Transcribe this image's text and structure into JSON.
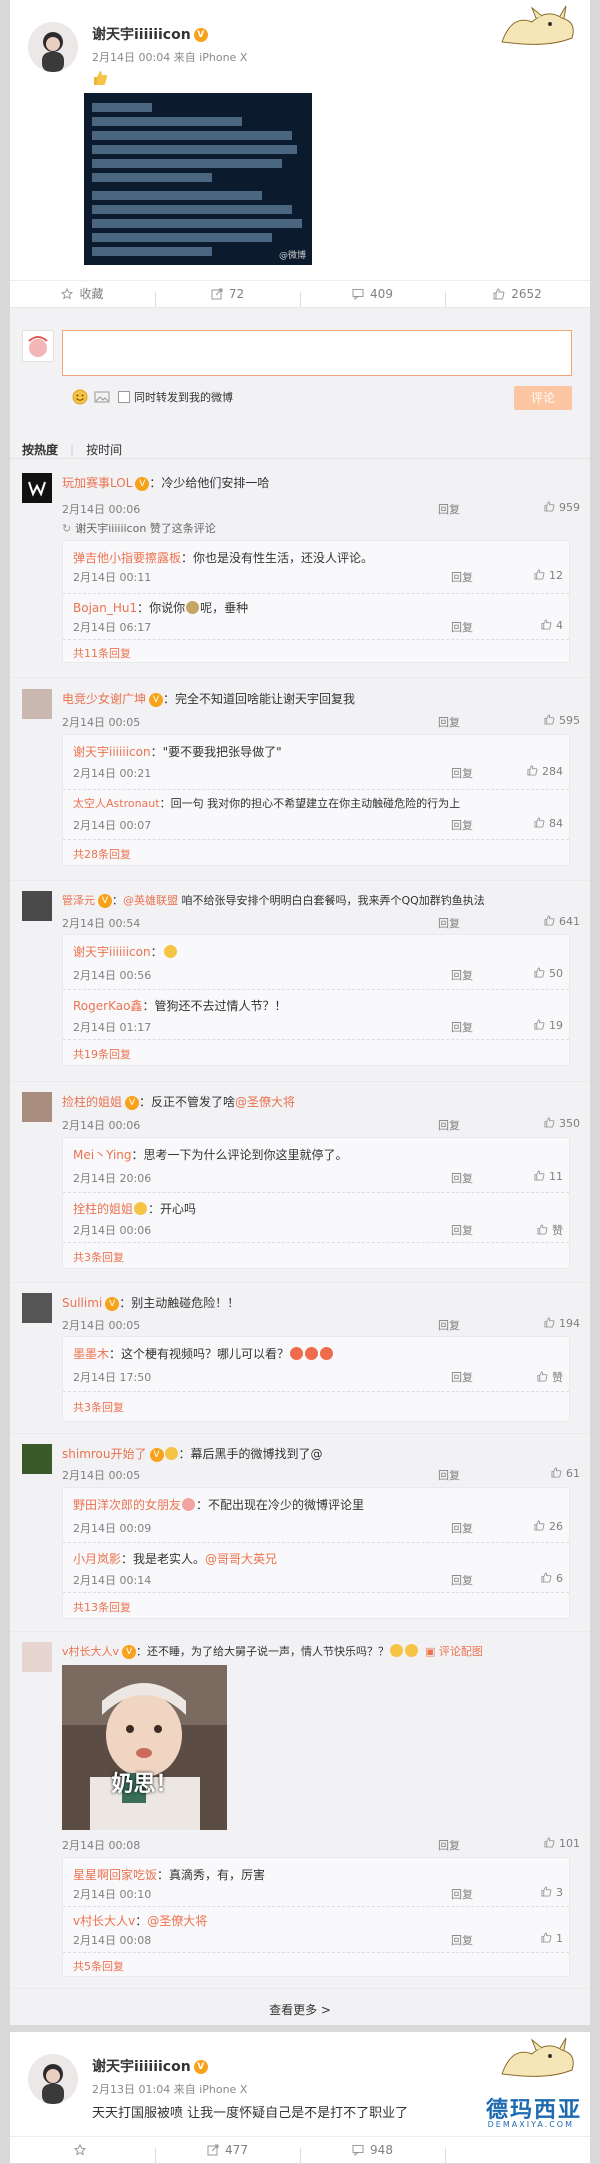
{
  "post1": {
    "author": "谢天宇iiiiiicon",
    "date": "2月14日 00:04",
    "source": "来自 iPhone X",
    "image_lines": [
      "小杯乐人：？？？",
      "杯乐人：D1最擅导张导替大家发上",
      "：我们粉租 有8000个号 4000台电脑 2000个手",
      "工✦伍 兄弟24小时为你服务！凡是加群633875387",
      "谢天宇张导请你别等你删号上✦看，安全，不对等",
      "天宇ICON：不和我们合作的",
      "D1最擅导张导替大家发上",
      "有8000个号 4000台电脑 2000个手",
      "兄弟24小时为你服务！凡是加群633875387",
      "张导请你别等你删号上✦看",
      "不对等回馈起"
    ],
    "image_watermark": "@微博",
    "actions": {
      "collect": "收藏",
      "forward": "72",
      "comment": "409",
      "like": "2652"
    }
  },
  "composer": {
    "sync_label": "同时转发到我的微博",
    "submit": "评论"
  },
  "sort": {
    "hot": "按热度",
    "time": "按时间"
  },
  "comments": [
    {
      "user": "玩加赛事LOL",
      "text": "：冷少给他们安排一哈",
      "time": "2月14日 00:06",
      "reply": "回复",
      "likes": "959",
      "liked_by": "谢天宇iiiiiicon 赞了这条评论",
      "subs": [
        {
          "user": "弹吉他小指要擦露板",
          "text": "：你也是没有性生活，还没人评论。",
          "time": "2月14日 00:11",
          "reply": "回复",
          "likes": "12"
        },
        {
          "user": "Bojan_Hu1",
          "text": "：你说你",
          "text2": "呢，垂种",
          "time": "2月14日 06:17",
          "reply": "回复",
          "likes": "4"
        }
      ],
      "more": "共11条回复"
    },
    {
      "user": "电竞少女谢广坤",
      "text": "：完全不知道回啥能让谢天宇回复我",
      "time": "2月14日 00:05",
      "reply": "回复",
      "likes": "595",
      "subs": [
        {
          "user": "谢天宇iiiiiicon",
          "text": "：\"要不要我把张导做了\"",
          "time": "2月14日 00:21",
          "reply": "回复",
          "likes": "284"
        },
        {
          "user": "太空人Astronaut",
          "text": "：回一句 我对你的担心不希望建立在你主动触碰危险的行为上",
          "time": "2月14日 00:07",
          "reply": "回复",
          "likes": "84"
        }
      ],
      "more": "共28条回复"
    },
    {
      "user": "管泽元",
      "text": "：",
      "mention": "@英雄联盟",
      "text2": " 咱不给张导安排个明明白白套餐吗，我来弄个QQ加群钓鱼执法",
      "time": "2月14日 00:54",
      "reply": "回复",
      "likes": "641",
      "subs": [
        {
          "user": "谢天宇iiiiiicon",
          "text": "：",
          "time": "2月14日 00:56",
          "reply": "回复",
          "likes": "50"
        },
        {
          "user": "RogerKao鑫",
          "text": "：管狗还不去过情人节？！",
          "time": "2月14日 01:17",
          "reply": "回复",
          "likes": "19"
        }
      ],
      "more": "共19条回复"
    },
    {
      "user": "捡柱的姐姐",
      "text": "：反正不管发了啥",
      "mention": "@圣僚大将",
      "time": "2月14日 00:06",
      "reply": "回复",
      "likes": "350",
      "subs": [
        {
          "user": "Mei丶Ying",
          "text": "：思考一下为什么评论到你这里就停了。",
          "time": "2月14日 20:06",
          "reply": "回复",
          "likes": "11"
        },
        {
          "user": "拴柱的姐姐",
          "text": "：开心吗",
          "time": "2月14日 00:06",
          "reply": "回复",
          "likes": "赞"
        }
      ],
      "more": "共3条回复"
    },
    {
      "user": "Sullimi",
      "text": "：别主动触碰危险！！",
      "time": "2月14日 00:05",
      "reply": "回复",
      "likes": "194",
      "subs": [
        {
          "user": "墨墨木",
          "text": "：这个梗有视频吗？哪儿可以看？",
          "time": "2月14日 17:50",
          "reply": "回复",
          "likes": "赞"
        }
      ],
      "more": "共3条回复"
    },
    {
      "user": "shimrou开始了",
      "text": "：幕后黑手的微博找到了@",
      "time": "2月14日 00:05",
      "reply": "回复",
      "likes": "61",
      "subs": [
        {
          "user": "野田洋次郎的女朋友",
          "text": "：不配出现在冷少的微博评论里",
          "time": "2月14日 00:09",
          "reply": "回复",
          "likes": "26"
        },
        {
          "user": "小月岚影",
          "text": "：我是老实人。",
          "mention": "@哥哥大英兄",
          "time": "2月14日 00:14",
          "reply": "回复",
          "likes": "6"
        }
      ],
      "more": "共13条回复"
    },
    {
      "user": "v村长大人v",
      "text": "：还不睡，为了给大舅子说一声，情人节快乐吗？？",
      "pic_comment": "评论配图",
      "time": "2月14日 00:08",
      "reply": "回复",
      "likes": "101",
      "image_caption": "奶思！",
      "subs": [
        {
          "user": "星星啊回家吃饭",
          "text": "：真滴秀，有，厉害",
          "time": "2月14日 00:10",
          "reply": "回复",
          "likes": "3"
        },
        {
          "user": "v村长大人v",
          "text": "：",
          "mention": "@圣僚大将",
          "time": "2月14日 00:08",
          "reply": "回复",
          "likes": "1"
        }
      ],
      "more": "共5条回复"
    }
  ],
  "view_more": "查看更多 >",
  "post2": {
    "author": "谢天宇iiiiiicon",
    "date": "2月13日 01:04",
    "source": "来自 iPhone X",
    "text": "天天打国服被喷 让我一度怀疑自己是不是打不了职业了",
    "actions": {
      "forward": "477",
      "comment": "948"
    }
  },
  "watermark": {
    "main": "德玛西亚",
    "sub": "DEMAXIYA.COM"
  }
}
